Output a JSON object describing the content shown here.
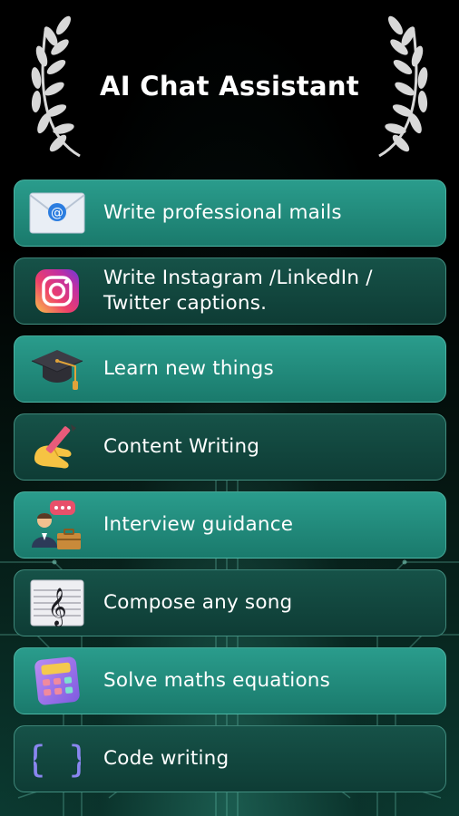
{
  "header": {
    "title": "AI Chat Assistant"
  },
  "features": [
    {
      "label": "Write professional mails",
      "icon": "email-icon"
    },
    {
      "label": "Write Instagram /LinkedIn / Twitter captions.",
      "icon": "instagram-icon"
    },
    {
      "label": "Learn new things",
      "icon": "graduation-cap-icon"
    },
    {
      "label": "Content Writing",
      "icon": "writing-hand-icon"
    },
    {
      "label": "Interview guidance",
      "icon": "interview-icon"
    },
    {
      "label": "Compose any song",
      "icon": "music-sheet-icon"
    },
    {
      "label": "Solve maths equations",
      "icon": "calculator-icon"
    },
    {
      "label": "Code writing",
      "icon": "code-braces-icon"
    }
  ],
  "colors": {
    "card_light": "#229080",
    "card_dark": "#124a41",
    "background": "#000000",
    "text": "#ffffff"
  }
}
